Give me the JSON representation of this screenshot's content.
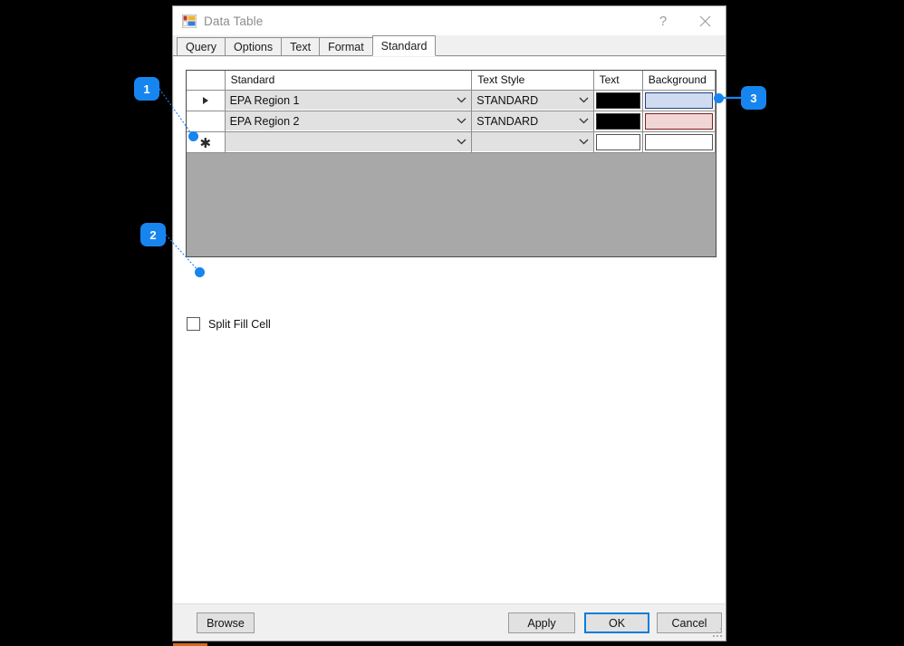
{
  "window": {
    "title": "Data Table",
    "app_icon": "data-table-icon",
    "help_label": "?",
    "close_label": "✕"
  },
  "tabs": [
    {
      "label": "Query",
      "active": false
    },
    {
      "label": "Options",
      "active": false
    },
    {
      "label": "Text",
      "active": false
    },
    {
      "label": "Format",
      "active": false
    },
    {
      "label": "Standard",
      "active": true
    }
  ],
  "grid": {
    "columns": [
      "",
      "Standard",
      "Text Style",
      "Text",
      "Background"
    ],
    "rows": [
      {
        "marker": "▶",
        "standard": "EPA Region 1",
        "text_style": "STANDARD",
        "text_color": "#000000",
        "background_color": "#cfdcf0",
        "background_border": "#1f3f7a"
      },
      {
        "marker": "",
        "standard": "EPA Region 2",
        "text_style": "STANDARD",
        "text_color": "#000000",
        "background_color": "#f2d5d5",
        "background_border": "#7a2020"
      },
      {
        "marker": "✱",
        "standard": "",
        "text_style": "",
        "text_color": "#ffffff",
        "background_color": "#ffffff",
        "background_border": "#555555"
      }
    ],
    "empty_area_color": "#a8a8a8"
  },
  "options": {
    "split_fill_cell_label": "Split Fill Cell",
    "split_fill_cell_checked": false
  },
  "buttons": {
    "browse": "Browse",
    "apply": "Apply",
    "ok": "OK",
    "cancel": "Cancel",
    "focus_color": "#0a7ddb"
  },
  "annotations": [
    {
      "number": "1",
      "target": "new-row-selector"
    },
    {
      "number": "2",
      "target": "split-fill-cell-checkbox"
    },
    {
      "number": "3",
      "target": "background-color-swatch-row-1"
    }
  ]
}
